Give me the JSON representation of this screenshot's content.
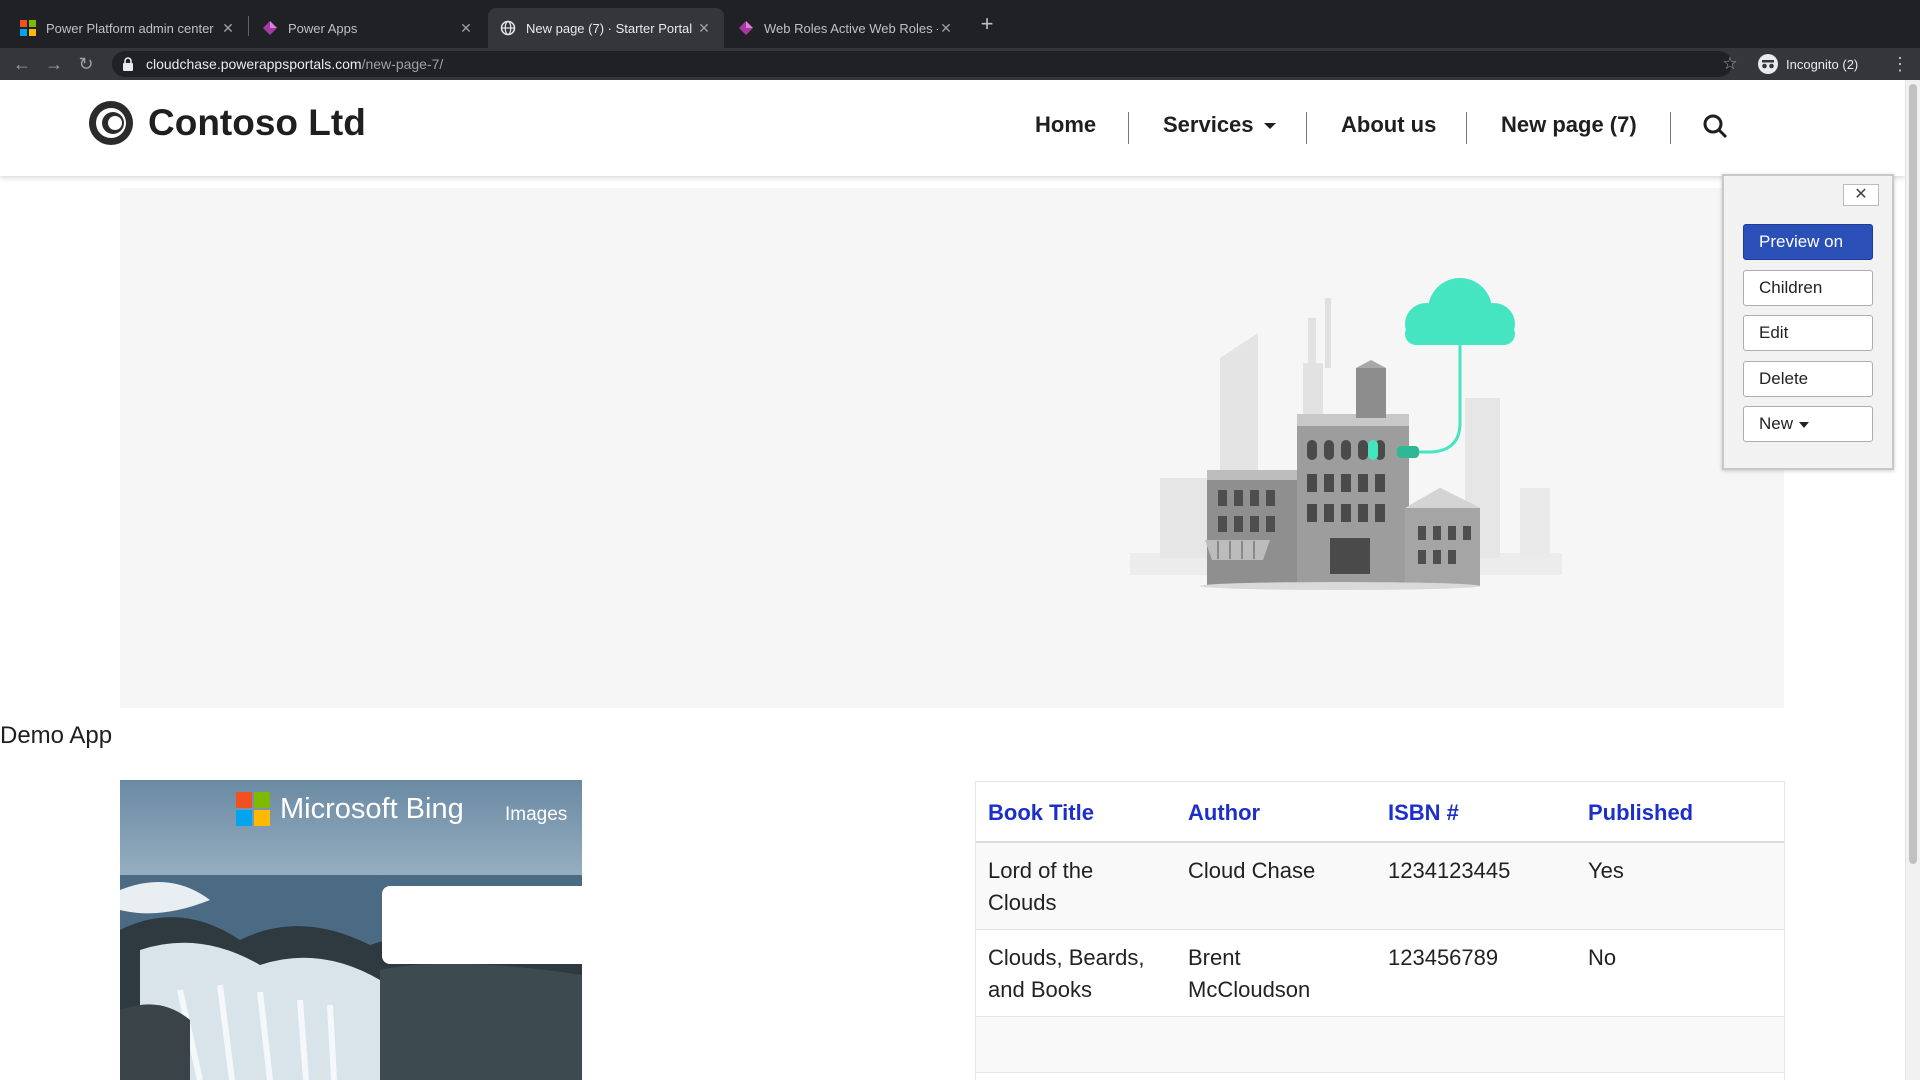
{
  "browser": {
    "tabs": [
      {
        "title": "Power Platform admin center",
        "active": false
      },
      {
        "title": "Power Apps",
        "active": false
      },
      {
        "title": "New page (7) · Starter Portal",
        "active": true
      },
      {
        "title": "Web Roles Active Web Roles -",
        "active": false
      }
    ],
    "new_tab": "+",
    "url_host": "cloudchase.powerappsportals.com",
    "url_path": "/new-page-7/",
    "incognito_label": "Incognito (2)"
  },
  "site": {
    "brand": "Contoso Ltd",
    "nav": {
      "home": "Home",
      "services": "Services",
      "about": "About us",
      "new_page": "New page (7)"
    }
  },
  "content": {
    "section_title": "Demo App",
    "bing": {
      "logo_text": "Microsoft Bing",
      "images_label": "Images"
    },
    "table": {
      "columns": [
        "Book Title",
        "Author",
        "ISBN #",
        "Published"
      ],
      "rows": [
        {
          "title_line1": "Lord of the",
          "title_line2": "Clouds",
          "author_line1": "Cloud Chase",
          "author_line2": "",
          "isbn": "1234123445",
          "published": "Yes"
        },
        {
          "title_line1": "Clouds, Beards,",
          "title_line2": "and Books",
          "author_line1": "Brent",
          "author_line2": "McCloudson",
          "isbn": "123456789",
          "published": "No"
        }
      ]
    }
  },
  "editor_panel": {
    "close": "✕",
    "preview": "Preview on",
    "children": "Children",
    "edit": "Edit",
    "delete": "Delete",
    "new": "New"
  },
  "colors": {
    "accent_blue": "#1c30c9",
    "primary_button": "#2a4fb7",
    "cloud_teal": "#45e5c2"
  }
}
